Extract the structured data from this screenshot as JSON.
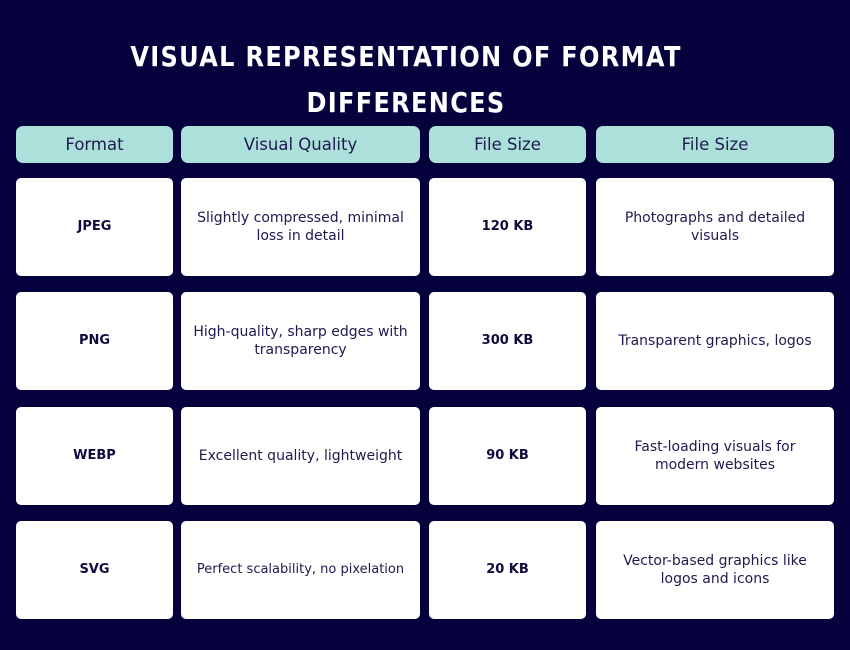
{
  "title": {
    "line1": "VISUAL REPRESENTATION OF FORMAT",
    "line2": "DIFFERENCES"
  },
  "table": {
    "headers": [
      "Format",
      "Visual Quality",
      "File Size",
      "File Size"
    ],
    "rows": [
      {
        "format": "JPEG",
        "quality": "Slightly compressed, minimal loss in detail",
        "size": "120 KB",
        "use": "Photographs and detailed visuals"
      },
      {
        "format": "PNG",
        "quality": "High-quality, sharp edges with transparency",
        "size": "300 KB",
        "use": "Transparent graphics, logos"
      },
      {
        "format": "WEBP",
        "quality": "Excellent quality, lightweight",
        "size": "90 KB",
        "use": "Fast-loading visuals for modern websites"
      },
      {
        "format": "SVG",
        "quality": "Perfect scalability, no pixelation",
        "size": "20 KB",
        "use": "Vector-based graphics like logos and icons"
      }
    ]
  },
  "colors": {
    "background": "#05013d",
    "header_fill": "#ade0da",
    "cell_fill": "#ffffff",
    "text_dark": "#1d1b4f"
  }
}
